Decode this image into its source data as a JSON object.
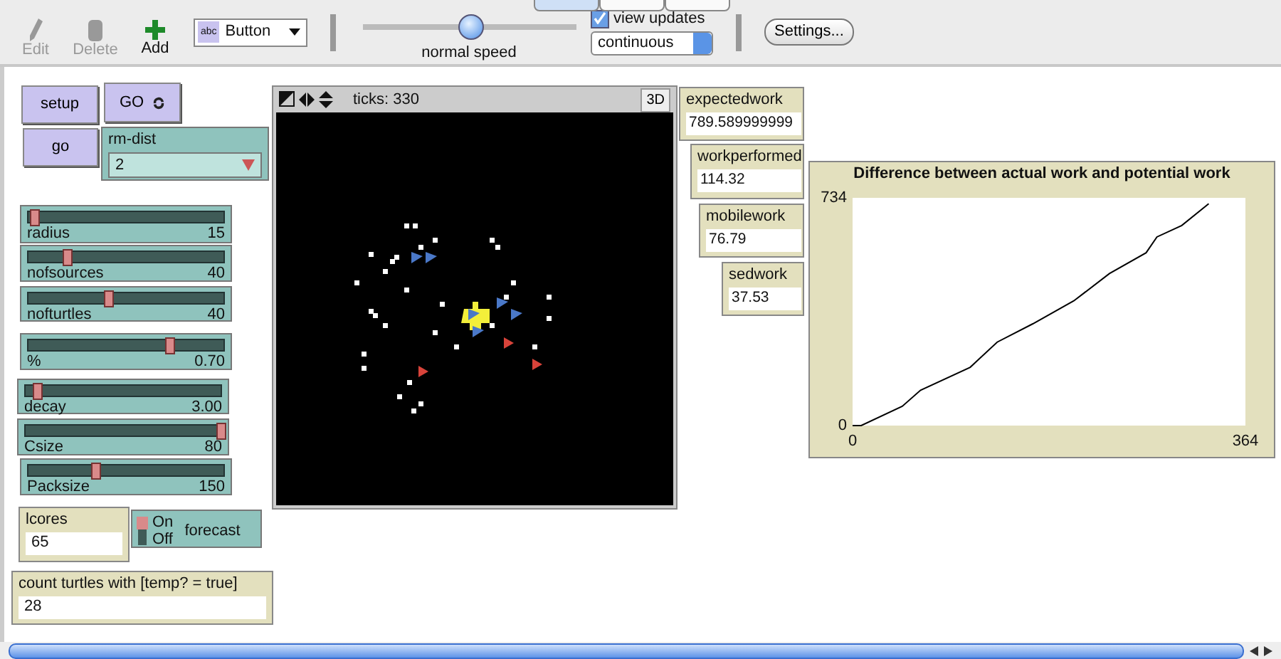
{
  "toolbar": {
    "tabs": [
      {
        "selected": true
      },
      {
        "selected": false
      },
      {
        "selected": false
      }
    ],
    "tools": [
      {
        "label": "Edit",
        "disabled": true
      },
      {
        "label": "Delete",
        "disabled": true
      },
      {
        "label": "Add",
        "disabled": false
      }
    ],
    "widget_type": {
      "badge": "abc",
      "value": "Button"
    },
    "speed": {
      "level": 0.5,
      "label": "normal speed"
    },
    "view_updates": {
      "label": "view updates",
      "checked": true
    },
    "update_mode": "continuous",
    "settings_button": "Settings..."
  },
  "buttons": [
    {
      "label": "setup",
      "forever": false
    },
    {
      "label": "GO",
      "forever": true
    },
    {
      "label": "go",
      "forever": false
    }
  ],
  "chooser": {
    "label": "rm-dist",
    "value": "2"
  },
  "sliders": [
    {
      "label": "radius",
      "value": "15",
      "level": 0.03
    },
    {
      "label": "nofsources",
      "value": "40",
      "level": 0.2
    },
    {
      "label": "nofturtles",
      "value": "40",
      "level": 0.41
    },
    {
      "label": "%",
      "value": "0.70",
      "level": 0.72
    },
    {
      "label": "decay",
      "value": "3.00",
      "level": 0.06
    },
    {
      "label": "Csize",
      "value": "80",
      "level": 1.0
    },
    {
      "label": "Packsize",
      "value": "150",
      "level": 0.34
    }
  ],
  "input": {
    "label": "lcores",
    "value": "65"
  },
  "switch": {
    "on_label": "On",
    "off_label": "Off",
    "label": "forecast",
    "on": true
  },
  "count_monitor": {
    "label": "count turtles with [temp? = true]",
    "value": "28"
  },
  "view": {
    "ticks": "ticks: 330",
    "button_3d": "3D"
  },
  "monitors": [
    {
      "label": "expectedwork",
      "value": "789.589999999"
    },
    {
      "label": "workperformed",
      "value": "114.32"
    },
    {
      "label": "mobilework",
      "value": "76.79"
    },
    {
      "label": "sedwork",
      "value": "37.53"
    }
  ],
  "plot": {
    "chart_data": {
      "type": "line",
      "title": "Difference between actual work and potential work",
      "xlim": [
        0,
        364
      ],
      "ylim": [
        0,
        734
      ],
      "xticks": [
        {
          "value": 0,
          "label": "0"
        },
        {
          "value": 364,
          "label": "364"
        }
      ],
      "yticks": [
        {
          "value": 0,
          "label": "0"
        },
        {
          "value": 734,
          "label": "734"
        }
      ],
      "x": [
        0,
        8,
        46,
        63,
        109,
        134,
        167,
        205,
        238,
        272,
        282,
        305,
        330
      ],
      "series": [
        {
          "color": "#000000",
          "values": [
            0,
            0,
            62,
            114,
            188,
            269,
            328,
            402,
            490,
            557,
            608,
            645,
            715
          ]
        }
      ]
    }
  }
}
